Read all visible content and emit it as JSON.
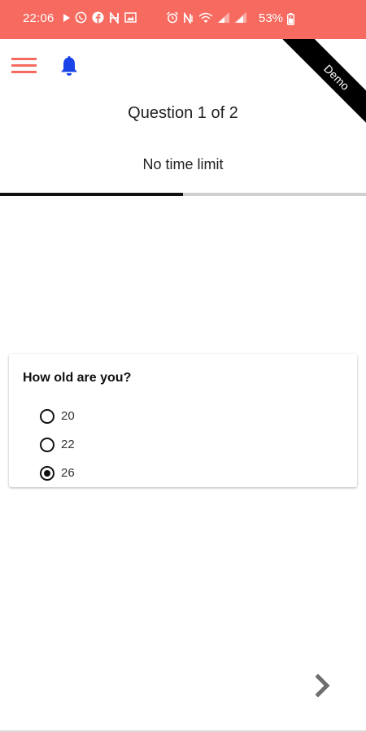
{
  "status_bar": {
    "time": "22:06",
    "battery": "53%",
    "color": "#f66a5f",
    "left_icons": [
      "play-icon",
      "whatsapp-icon",
      "facebook-icon",
      "n-app-icon",
      "gallery-icon"
    ],
    "right_icons": [
      "alarm-icon",
      "nfc-icon",
      "wifi-icon",
      "signal-icon",
      "signal-icon",
      "battery-icon"
    ]
  },
  "app_bar": {
    "menu_icon": "hamburger-menu-icon",
    "menu_color": "#f66a5f",
    "notification_icon": "bell-icon",
    "notification_color": "#1a44e8",
    "ribbon_label": "Demo"
  },
  "quiz": {
    "title": "Question 1 of 2",
    "time_limit": "No time limit",
    "progress": 0.5,
    "question": {
      "text": "How old are you?",
      "options": [
        {
          "label": "20",
          "selected": false
        },
        {
          "label": "22",
          "selected": false
        },
        {
          "label": "26",
          "selected": true
        }
      ]
    },
    "next_icon": "chevron-right-icon"
  }
}
